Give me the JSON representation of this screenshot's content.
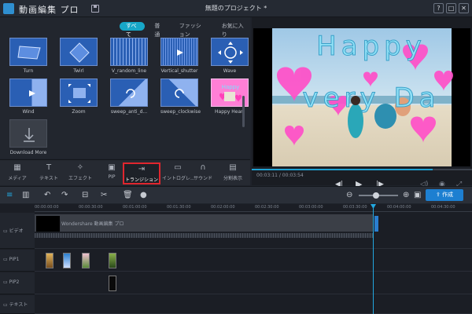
{
  "app": {
    "title": "動画編集 プロ",
    "document_title": "無題のプロジェクト *",
    "window_buttons": [
      "?",
      "□",
      "✕"
    ]
  },
  "library": {
    "filters": [
      "すべて",
      "普通",
      "ファッション",
      "お気に入り"
    ],
    "active_filter": "すべて",
    "items": [
      {
        "label": "Turn"
      },
      {
        "label": "Twirl"
      },
      {
        "label": "V_random_line"
      },
      {
        "label": "Vertical_shutter"
      },
      {
        "label": "Wave"
      },
      {
        "label": "Wind"
      },
      {
        "label": "Zoom"
      },
      {
        "label": "sweep_anti_d..."
      },
      {
        "label": "sweep_clockwise"
      },
      {
        "label": "Happy Heart"
      },
      {
        "label": "Download More"
      }
    ]
  },
  "modules": [
    {
      "label": "メディア",
      "icon": "media-icon"
    },
    {
      "label": "テキスト",
      "icon": "text-icon"
    },
    {
      "label": "エフェクト",
      "icon": "effect-icon"
    },
    {
      "label": "PIP",
      "icon": "pip-icon"
    },
    {
      "label": "トランジション",
      "icon": "transition-icon",
      "active": true
    },
    {
      "label": "イントログレ...",
      "icon": "intro-icon"
    },
    {
      "label": "サウンド",
      "icon": "sound-icon"
    },
    {
      "label": "分割表示",
      "icon": "split-icon"
    }
  ],
  "preview": {
    "timecode": "00:03:11 / 00:03:54",
    "progress": 0.82,
    "overlay_text_line1": "Happy",
    "overlay_text_line2": "very Da"
  },
  "toolbar": {
    "export_label": "作成"
  },
  "timeline": {
    "ruler_ticks": [
      "00:00:00:00",
      "00:00:30:00",
      "00:01:00:00",
      "00:01:30:00",
      "00:02:00:00",
      "00:02:30:00",
      "00:03:00:00",
      "00:03:30:00",
      "00:04:00:00",
      "00:04:30:00"
    ],
    "tracks": [
      {
        "label": "ビデオ"
      },
      {
        "label": "PIP1"
      },
      {
        "label": "PIP2"
      },
      {
        "label": "テキスト"
      }
    ],
    "video_clip_title": "Wondershare 動画編集 プロ"
  },
  "colors": {
    "accent": "#17a7c8",
    "highlight": "#e0262e",
    "tile_blue": "#2a5fb4",
    "heart_pink": "#ff4fc8"
  }
}
